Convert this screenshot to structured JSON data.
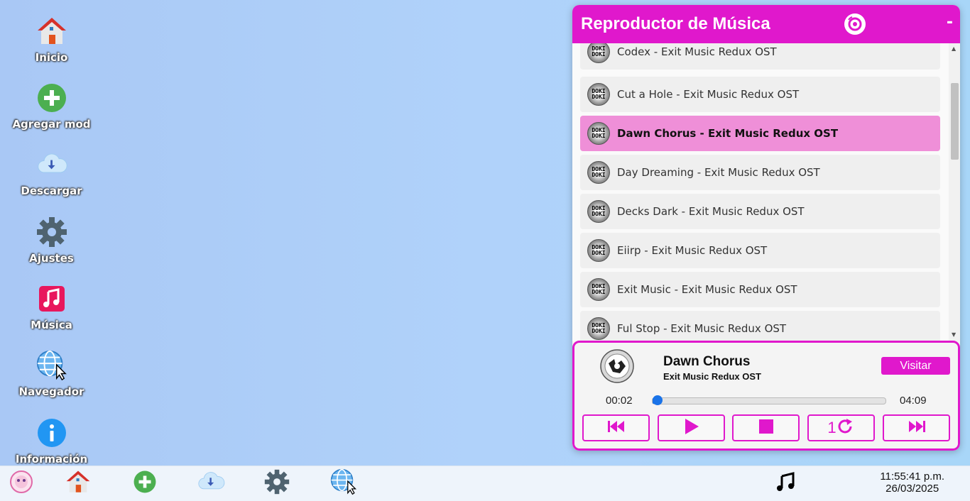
{
  "desktop": {
    "icons": [
      {
        "label": "Inicio",
        "icon": "home-icon"
      },
      {
        "label": "Agregar mod",
        "icon": "add-icon"
      },
      {
        "label": "Descargar",
        "icon": "cloud-download-icon"
      },
      {
        "label": "Ajustes",
        "icon": "gear-icon"
      },
      {
        "label": "Música",
        "icon": "music-note-icon"
      },
      {
        "label": "Navegador",
        "icon": "globe-icon"
      },
      {
        "label": "Información",
        "icon": "info-icon"
      }
    ]
  },
  "player": {
    "title": "Reproductor de Música",
    "minimize": "-",
    "tracks": [
      {
        "name": "Codex - Exit Music Redux OST",
        "cover_text": "DOKI DOKI"
      },
      {
        "name": "Cut a Hole - Exit Music Redux OST",
        "cover_text": "DOKI DOKI"
      },
      {
        "name": "Dawn Chorus - Exit Music Redux OST",
        "cover_text": "DOKI DOKI"
      },
      {
        "name": "Day Dreaming - Exit Music Redux OST",
        "cover_text": "DOKI DOKI"
      },
      {
        "name": "Decks Dark - Exit Music Redux OST",
        "cover_text": "DOKI DOKI"
      },
      {
        "name": "Eiirp - Exit Music Redux OST",
        "cover_text": "DOKI DOKI"
      },
      {
        "name": "Exit Music - Exit Music Redux OST",
        "cover_text": "DOKI DOKI"
      },
      {
        "name": "Ful Stop - Exit Music Redux OST",
        "cover_text": "DOKI DOKI"
      }
    ],
    "active_index": 2,
    "now_playing": {
      "title": "Dawn Chorus",
      "album": "Exit Music Redux OST",
      "visit_label": "Visitar",
      "elapsed": "00:02",
      "duration": "04:09",
      "progress_fraction": 0.008
    },
    "controls": [
      {
        "name": "previous-button",
        "icon": "skip-back-icon"
      },
      {
        "name": "play-button",
        "icon": "play-icon"
      },
      {
        "name": "stop-button",
        "icon": "stop-icon"
      },
      {
        "name": "repeat-one-button",
        "icon": "repeat-one-icon",
        "text": "1"
      },
      {
        "name": "next-button",
        "icon": "skip-forward-icon"
      }
    ]
  },
  "taskbar": {
    "items": [
      "avatar",
      "home-icon",
      "add-icon",
      "cloud-download-icon",
      "gear-icon",
      "globe-icon"
    ],
    "music_icon": "music-note-icon",
    "time": "11:55:41 p.m.",
    "date": "26/03/2025"
  },
  "colors": {
    "accent": "#e018cc",
    "active_track": "#ef8fd8",
    "progress": "#1a73e8"
  }
}
